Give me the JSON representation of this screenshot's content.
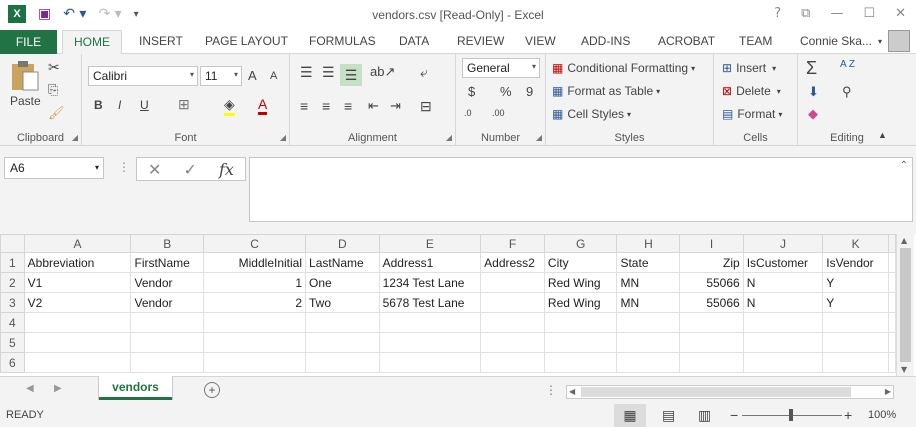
{
  "window": {
    "title": "vendors.csv  [Read-Only] - Excel",
    "help": "?",
    "restore": "⧉",
    "minimize": "—",
    "maximize": "☐",
    "close": "✕"
  },
  "qat": {
    "logo": "X",
    "save": "💾",
    "undo": "↶ ▾",
    "redo": "↷ ▾",
    "customize": "▾"
  },
  "tabs": {
    "file": "FILE",
    "items": [
      "HOME",
      "INSERT",
      "PAGE LAYOUT",
      "FORMULAS",
      "DATA",
      "REVIEW",
      "VIEW",
      "ADD-INS",
      "ACROBAT",
      "TEAM"
    ],
    "active": "HOME",
    "user": "Connie Ska..."
  },
  "ribbon": {
    "clipboard": {
      "label": "Clipboard",
      "paste": "Paste"
    },
    "font": {
      "label": "Font",
      "name": "Calibri",
      "size": "11",
      "bold": "B",
      "italic": "I",
      "underline": "U",
      "grow": "A",
      "shrink": "A"
    },
    "alignment": {
      "label": "Alignment"
    },
    "number": {
      "label": "Number",
      "format": "General",
      "currency": "$",
      "percent": "%",
      "comma": "9",
      "inc_decimal": ".0",
      "dec_decimal": ".00"
    },
    "styles": {
      "label": "Styles",
      "conditional": "Conditional Formatting",
      "table": "Format as Table",
      "cell": "Cell Styles"
    },
    "cells": {
      "label": "Cells",
      "insert": "Insert",
      "delete": "Delete",
      "format": "Format"
    },
    "editing": {
      "label": "Editing",
      "sum": "Σ",
      "sort": "A Z",
      "find": "🔭"
    }
  },
  "formula_bar": {
    "name_box": "A6",
    "cancel": "✕",
    "enter": "✓",
    "fx": "fx",
    "value": ""
  },
  "sheet": {
    "columns": [
      "A",
      "B",
      "C",
      "D",
      "E",
      "F",
      "G",
      "H",
      "I",
      "J",
      "K"
    ],
    "rows": [
      {
        "n": "1",
        "cells": [
          "Abbreviation",
          "FirstName",
          "MiddleInitial",
          "LastName",
          "Address1",
          "Address2",
          "City",
          "State",
          "Zip",
          "IsCustomer",
          "IsVendor"
        ]
      },
      {
        "n": "2",
        "cells": [
          "V1",
          "Vendor",
          "1",
          "One",
          "1234 Test Lane",
          "",
          "Red Wing",
          "MN",
          "55066",
          "N",
          "Y"
        ]
      },
      {
        "n": "3",
        "cells": [
          "V2",
          "Vendor",
          "2",
          "Two",
          "5678 Test Lane",
          "",
          "Red Wing",
          "MN",
          "55066",
          "N",
          "Y"
        ]
      },
      {
        "n": "4",
        "cells": [
          "",
          "",
          "",
          "",
          "",
          "",
          "",
          "",
          "",
          "",
          ""
        ]
      },
      {
        "n": "5",
        "cells": [
          "",
          "",
          "",
          "",
          "",
          "",
          "",
          "",
          "",
          "",
          ""
        ]
      },
      {
        "n": "6",
        "cells": [
          "",
          "",
          "",
          "",
          "",
          "",
          "",
          "",
          "",
          "",
          ""
        ]
      }
    ],
    "numeric_cols": [
      2,
      8
    ]
  },
  "sheet_tabs": {
    "active": "vendors",
    "add": "+"
  },
  "status": {
    "mode": "READY",
    "zoom": "100%",
    "zoom_out": "−",
    "zoom_in": "+"
  }
}
